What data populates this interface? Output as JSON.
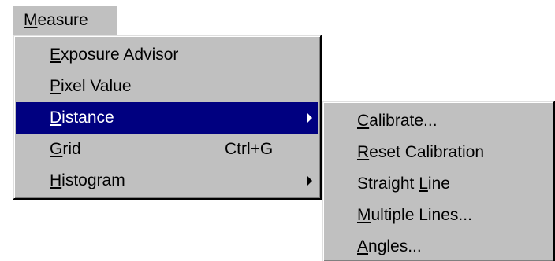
{
  "menubar": {
    "measure": {
      "hotkey": "M",
      "rest": "easure"
    }
  },
  "main_menu": {
    "items": [
      {
        "hotkey": "E",
        "rest": "xposure Advisor"
      },
      {
        "hotkey": "P",
        "rest": "ixel Value"
      },
      {
        "hotkey": "D",
        "rest": "istance",
        "submenu": true,
        "highlighted": true
      },
      {
        "hotkey": "G",
        "rest": "rid",
        "shortcut": "Ctrl+G"
      },
      {
        "hotkey": "H",
        "rest": "istogram",
        "submenu": true
      }
    ]
  },
  "distance_submenu": {
    "items": [
      {
        "pre": "",
        "hotkey": "C",
        "rest": "alibrate..."
      },
      {
        "pre": "",
        "hotkey": "R",
        "rest": "eset Calibration"
      },
      {
        "pre": "Straight ",
        "hotkey": "L",
        "rest": "ine"
      },
      {
        "pre": "",
        "hotkey": "M",
        "rest": "ultiple Lines..."
      },
      {
        "pre": "",
        "hotkey": "A",
        "rest": "ngles..."
      }
    ]
  },
  "colors": {
    "menu_background": "#c0c0c0",
    "highlight_background": "#000080",
    "highlight_text": "#ffffff",
    "text": "#000000"
  }
}
